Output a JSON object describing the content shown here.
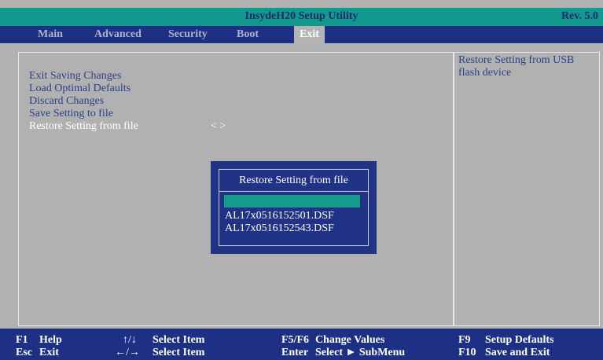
{
  "header": {
    "title": "InsydeH20 Setup Utility",
    "rev": "Rev. 5.0"
  },
  "menu": {
    "tabs": [
      {
        "label": "Main"
      },
      {
        "label": "Advanced"
      },
      {
        "label": "Security"
      },
      {
        "label": "Boot"
      },
      {
        "label": "Exit",
        "active": true
      }
    ]
  },
  "main": {
    "options": [
      {
        "label": "Exit Saving Changes"
      },
      {
        "label": "Load Optimal Defaults"
      },
      {
        "label": "Discard Changes"
      },
      {
        "label": "Save Setting to file"
      },
      {
        "label": "Restore Setting from file",
        "selected": true,
        "value": "< >"
      }
    ]
  },
  "help": {
    "text": "Restore Setting from USB flash device"
  },
  "popup": {
    "title": "Restore Setting from file",
    "items": [
      "AL17x0516152501.DSF",
      "AL17x0516152543.DSF"
    ]
  },
  "footer": {
    "row1": [
      {
        "key": "F1",
        "label": "Help"
      },
      {
        "key": "↑/↓",
        "label": "Select Item"
      },
      {
        "key": "F5/F6",
        "label": "Change Values"
      },
      {
        "key": "F9",
        "label": "Setup Defaults"
      }
    ],
    "row2": [
      {
        "key": "Esc",
        "label": "Exit"
      },
      {
        "key": "←/→",
        "label": "Select Item"
      },
      {
        "key": "Enter",
        "label": "Select ► SubMenu"
      },
      {
        "key": "F10",
        "label": "Save and Exit"
      }
    ]
  },
  "colors": {
    "accent": "#11998e",
    "navy": "#1d3083",
    "panel": "#b1b1b1",
    "text": "#2b3f86"
  }
}
